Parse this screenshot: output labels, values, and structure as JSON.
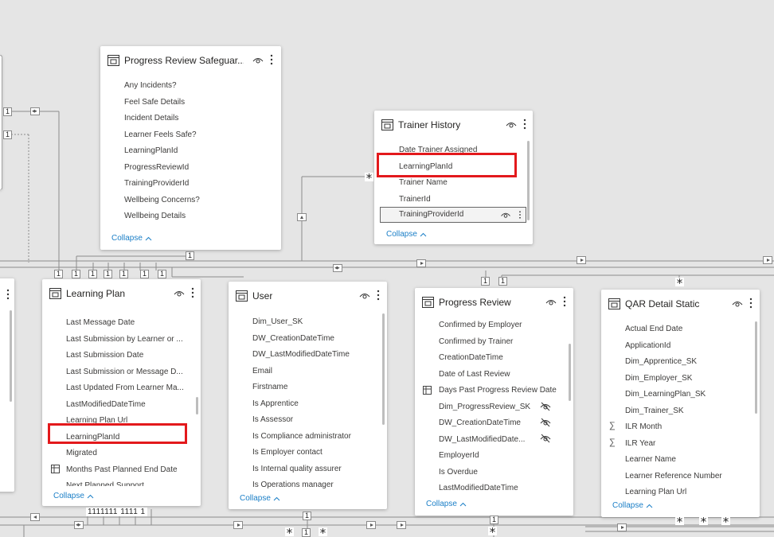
{
  "tables": {
    "safeguarding": {
      "title": "Progress Review Safeguar...",
      "fields": [
        "Any Incidents?",
        "Feel Safe Details",
        "Incident Details",
        "Learner Feels Safe?",
        "LearningPlanId",
        "ProgressReviewId",
        "TrainingProviderId",
        "Wellbeing Concerns?",
        "Wellbeing Details"
      ],
      "collapse": "Collapse"
    },
    "trainer_history": {
      "title": "Trainer History",
      "fields": [
        "Date Trainer Assigned",
        "LearningPlanId",
        "Trainer Name",
        "TrainerId",
        "TrainingProviderId"
      ],
      "collapse": "Collapse"
    },
    "learning_plan": {
      "title": "Learning Plan",
      "fields": [
        "Last Message Date",
        "Last Submission by Learner or ...",
        "Last Submission Date",
        "Last Submission or Message D...",
        "Last Updated From Learner Ma...",
        "LastModifiedDateTime",
        "Learning Plan Url",
        "LearningPlanId",
        "Migrated",
        "Months Past Planned End Date",
        "Next Planned Support"
      ],
      "collapse": "Collapse"
    },
    "user": {
      "title": "User",
      "fields": [
        "Dim_User_SK",
        "DW_CreationDateTime",
        "DW_LastModifiedDateTime",
        "Email",
        "Firstname",
        "Is Apprentice",
        "Is Assessor",
        "Is Compliance administrator",
        "Is Employer contact",
        "Is Internal quality assurer",
        "Is Operations manager"
      ],
      "collapse": "Collapse"
    },
    "progress_review": {
      "title": "Progress Review",
      "fields": [
        "Confirmed by Employer",
        "Confirmed by Trainer",
        "CreationDateTime",
        "Date of Last Review",
        "Days Past Progress Review Date",
        "Dim_ProgressReview_SK",
        "DW_CreationDateTime",
        "DW_LastModifiedDate...",
        "EmployerId",
        "Is Overdue",
        "LastModifiedDateTime"
      ],
      "collapse": "Collapse"
    },
    "qar_detail": {
      "title": "QAR Detail Static",
      "fields": [
        "Actual End Date",
        "ApplicationId",
        "Dim_Apprentice_SK",
        "Dim_Employer_SK",
        "Dim_LearningPlan_SK",
        "Dim_Trainer_SK",
        "ILR Month",
        "ILR Year",
        "Learner Name",
        "Learner Reference Number",
        "Learning Plan Url"
      ],
      "collapse": "Collapse"
    }
  },
  "cardinality": {
    "one": "1",
    "many": "*",
    "lp_multi": "1111111 1111 1"
  },
  "icons": {
    "table": "table-icon",
    "eye": "eye-icon",
    "hidden": "hidden-eye-icon",
    "measure": "sigma-icon",
    "calc": "calculated-column-icon",
    "more": "more-options-icon",
    "collapse": "chevron-up-icon"
  },
  "colors": {
    "canvas": "#e5e5e5",
    "highlight": "#e3191c",
    "link": "#1b7fc7"
  }
}
